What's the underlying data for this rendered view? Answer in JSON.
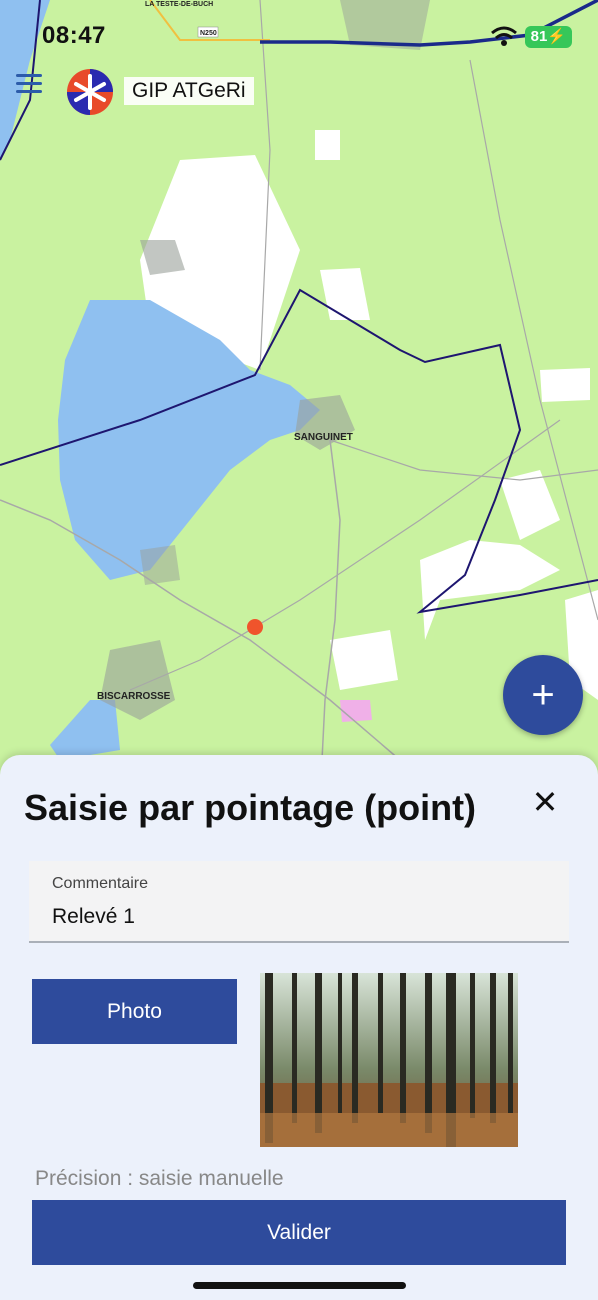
{
  "status": {
    "time": "08:47",
    "battery": "81"
  },
  "header": {
    "title": "GIP ATGeRi"
  },
  "map": {
    "labels": {
      "sanguinet": "SANGUINET",
      "biscarrosse": "BISCARROSSE",
      "road": "N250",
      "la_teste": "LA TESTE-DE-BUCH"
    },
    "colors": {
      "land": "#c9f2a0",
      "water": "#8fc0f0",
      "boundary": "#1e1670",
      "marker": "#f0542c"
    }
  },
  "fab": {
    "icon": "plus-icon",
    "label": "+"
  },
  "sheet": {
    "title": "Saisie par pointage (point)",
    "close": "✕",
    "comment": {
      "label": "Commentaire",
      "value": "Relevé 1"
    },
    "photo_button": "Photo",
    "precision": "Précision : saisie manuelle",
    "validate_button": "Valider"
  },
  "accent": "#2e4b9c"
}
